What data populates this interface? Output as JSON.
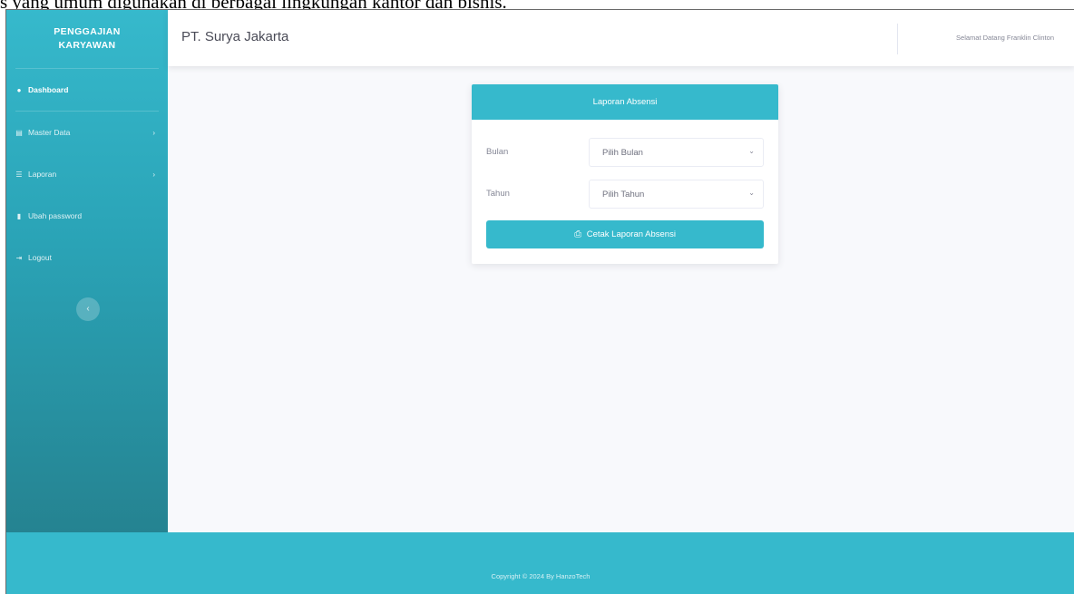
{
  "document": {
    "caption": "s yang umum digunakan di berbagai lingkungan kantor dan bisnis."
  },
  "sidebar": {
    "brand": {
      "line1": "PENGGAJIAN",
      "line2": "KARYAWAN"
    },
    "items": [
      {
        "label": "Dashboard",
        "icon": "tachometer-icon",
        "glyph": "●",
        "active": true,
        "has_caret": false
      },
      {
        "label": "Master Data",
        "icon": "folder-icon",
        "glyph": "▤",
        "active": false,
        "has_caret": true
      },
      {
        "label": "Laporan",
        "icon": "list-icon",
        "glyph": "☰",
        "active": false,
        "has_caret": true
      },
      {
        "label": "Ubah password",
        "icon": "lock-icon",
        "glyph": "▮",
        "active": false,
        "has_caret": false
      },
      {
        "label": "Logout",
        "icon": "sign-out-icon",
        "glyph": "⇥",
        "active": false,
        "has_caret": false
      }
    ],
    "caret_glyph": "›",
    "toggle_glyph": "‹"
  },
  "topbar": {
    "company": "PT. Surya Jakarta",
    "welcome": "Selamat Datang Franklin Clinton"
  },
  "card": {
    "title": "Laporan Absensi",
    "month": {
      "label": "Bulan",
      "selected": "Pilih Bulan"
    },
    "year": {
      "label": "Tahun",
      "selected": "Pilih Tahun"
    },
    "select_arrow_glyph": "⌄",
    "print_button": {
      "label": "Cetak Laporan Absensi",
      "icon": "print-icon",
      "glyph": "⎙"
    }
  },
  "footer": {
    "text": "Copyright © 2024 By HanzoTech"
  },
  "colors": {
    "accent": "#36b9cc",
    "sidebar_dark": "#258391",
    "background": "#f8f9fc"
  }
}
